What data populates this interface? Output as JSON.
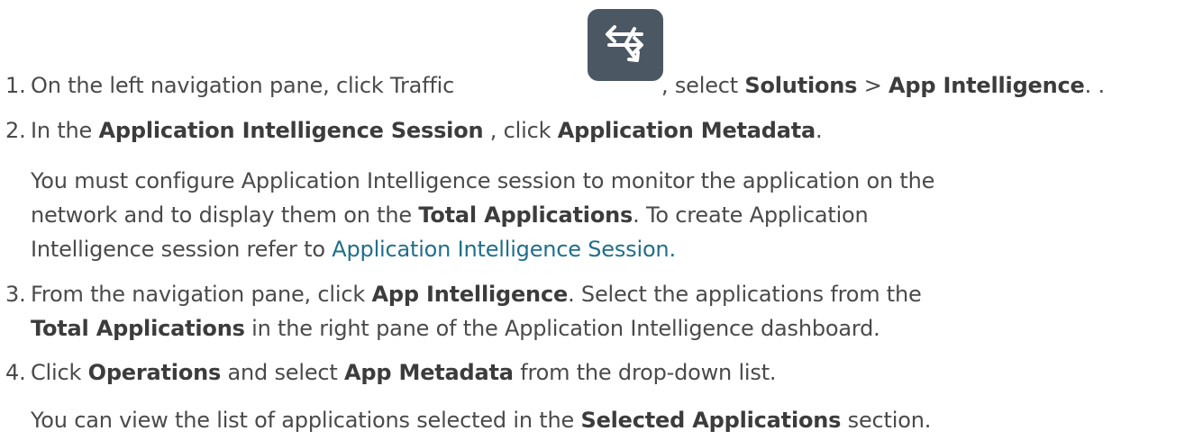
{
  "steps": [
    {
      "num": "1.",
      "pre": "On the left navigation pane, click Traffic ",
      "icon": "traffic-icon",
      "mid": ", select ",
      "b1": "Solutions",
      "sep": " > ",
      "b2": "App Intelligence",
      "post": ". ."
    },
    {
      "num": "2.",
      "pre": "In the ",
      "b1": "Application Intelligence Session",
      "mid": " , click ",
      "b2": "Application Metadata",
      "post": "."
    },
    {
      "num": "3.",
      "pre": "From the navigation pane, click ",
      "b1": "App Intelligence",
      "mid": ". Select the applications from the",
      "b2": "Total Applications",
      "post": " in the right pane of the Application Intelligence dashboard."
    },
    {
      "num": "4.",
      "pre": "Click ",
      "b1": "Operations",
      "mid": " and select ",
      "b2": "App Metadata",
      "post": " from the drop-down list."
    }
  ],
  "note2": {
    "line1": "You must configure Application Intelligence session to monitor the application on the",
    "line2_pre": "network and to display them on the ",
    "line2_bold": "Total Applications",
    "line2_post": ". To create Application",
    "line3_pre": "Intelligence session refer to ",
    "line3_link": "Application Intelligence Session."
  },
  "note4": {
    "pre": "You can view the list of applications selected in the ",
    "bold": "Selected Applications",
    "post": " section."
  },
  "colors": {
    "text": "#4a4a4a",
    "link": "#1f6f8b",
    "icon_bg": "#4b5863"
  }
}
